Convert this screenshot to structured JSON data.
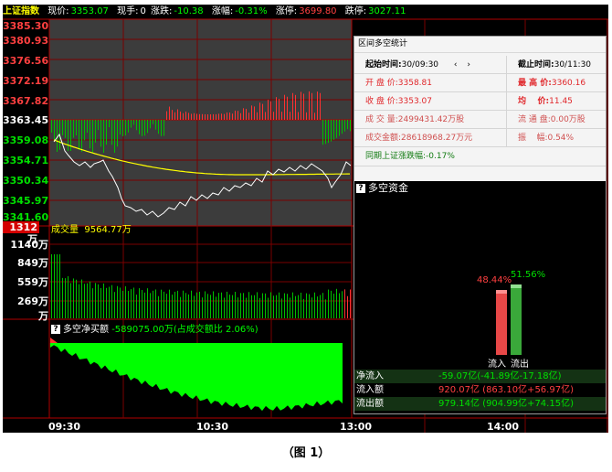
{
  "header": {
    "index_name": "上证指数",
    "price_label": "现价:",
    "price": "3353.07",
    "volume_label": "现手:",
    "volume": "0",
    "change_label": "涨跌:",
    "change": "-10.38",
    "pct_label": "涨幅:",
    "pct": "-0.31%",
    "limit_up_label": "涨停:",
    "limit_up": "3699.80",
    "limit_down_label": "跌停:",
    "limit_down": "3027.11"
  },
  "price_axis": {
    "top": "3385.30",
    "ticks": [
      "3380.93",
      "3376.56",
      "3372.19",
      "3367.82"
    ],
    "base": "3363.45",
    "low_ticks": [
      "3359.08",
      "3354.71",
      "3350.34",
      "3345.97",
      "3341.60"
    ]
  },
  "volume_axis": {
    "highlight": "1312万",
    "title": "成交量",
    "value": "9564.77万",
    "ticks": [
      "1140万",
      "849万",
      "559万",
      "269万",
      "万"
    ]
  },
  "net_buy": {
    "title": "多空净买额",
    "value": "-589075.00万(占成交额比 2.06%)"
  },
  "time_axis": [
    "09:30",
    "10:30",
    "13:00",
    "14:00"
  ],
  "stats_panel": {
    "title": "区间多空统计",
    "start_label": "起始时间:",
    "start": "30/09:30",
    "end_label": "截止时间:",
    "end": "30/11:30",
    "open_label": "开 盘 价:",
    "open": "3358.81",
    "high_label": "最 高 价:",
    "high": "3360.16",
    "close_label": "收 盘 价:",
    "close": "3353.07",
    "avg_label": "均    价:",
    "avg": "11.45",
    "turnover_label": "成 交 量:",
    "turnover": "2499431.42万股",
    "float_label": "流 通 盘:",
    "float": "0.00万股",
    "amount_label": "成交金额:",
    "amount": "28618968.27万元",
    "amplitude_label": "振    幅:",
    "amplitude": "0.54%",
    "same_period_label": "同期上证涨跌幅:",
    "same_period": "-0.17%"
  },
  "flow_panel": {
    "title": "多空资金",
    "inflow_pct": "48.44%",
    "outflow_pct": "51.56%",
    "inflow_bar_label": "流入",
    "outflow_bar_label": "流出",
    "rows": [
      {
        "label": "净流入",
        "value": "-59.07亿(-41.89亿-17.18亿)"
      },
      {
        "label": "流入额",
        "value": "920.07亿 (863.10亿+56.97亿)"
      },
      {
        "label": "流出额",
        "value": "979.14亿 (904.99亿+74.15亿)"
      }
    ]
  },
  "caption": "（图 1）",
  "colors": {
    "up": "#ff3232",
    "down": "#00c000",
    "avg_line": "#ffff00",
    "price_line": "#ffffff",
    "axis_red": "#c00000",
    "netbuy_fill": "#00ff00"
  }
}
